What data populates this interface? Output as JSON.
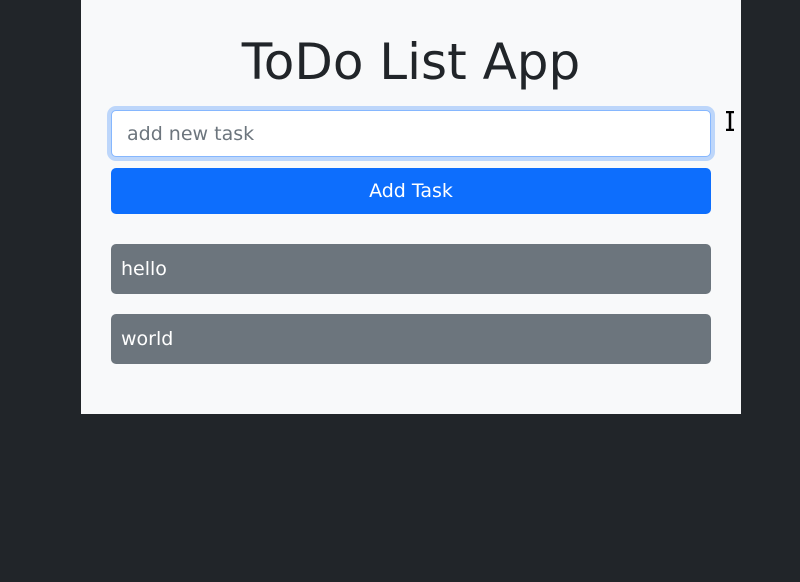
{
  "app": {
    "title": "ToDo List App"
  },
  "form": {
    "input_value": "",
    "input_placeholder": "add new task",
    "add_button_label": "Add Task"
  },
  "tasks": [
    {
      "label": "hello"
    },
    {
      "label": "world"
    }
  ],
  "colors": {
    "page_background": "#212529",
    "card_background": "#f8f9fa",
    "primary": "#0d6efd",
    "task_background": "#6c757d",
    "text": "#212529"
  },
  "icons": {
    "cursor": "text-cursor-icon"
  }
}
